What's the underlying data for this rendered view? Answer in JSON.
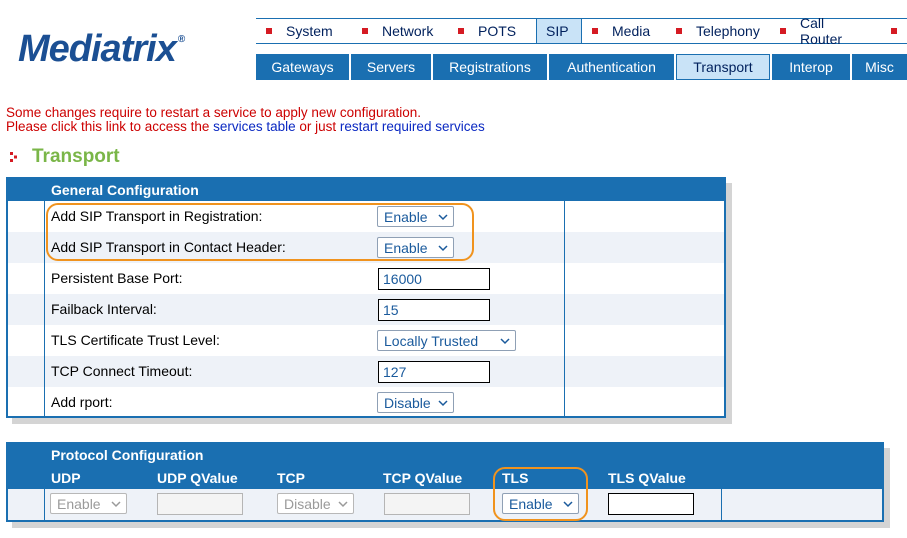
{
  "logo": {
    "text": "Mediatrix",
    "mark": "®"
  },
  "top_nav": [
    {
      "label": "System"
    },
    {
      "label": "Network"
    },
    {
      "label": "POTS"
    },
    {
      "label": "SIP",
      "active": true
    },
    {
      "label": "Media"
    },
    {
      "label": "Telephony"
    },
    {
      "label": "Call Router"
    }
  ],
  "sub_nav": [
    {
      "label": "Gateways"
    },
    {
      "label": "Servers"
    },
    {
      "label": "Registrations"
    },
    {
      "label": "Authentication"
    },
    {
      "label": "Transport",
      "active": true
    },
    {
      "label": "Interop"
    },
    {
      "label": "Misc"
    }
  ],
  "notice": {
    "line1": "Some changes require to restart a service to apply new configuration.",
    "line2_prefix": "Please click this link to access the ",
    "services_table_link": "services table",
    "line2_middle": " or just ",
    "restart_link": "restart required services"
  },
  "page_title": "Transport",
  "general": {
    "title": "General Configuration",
    "rows": [
      {
        "label": "Add SIP Transport in Registration:",
        "type": "select",
        "value": "Enable"
      },
      {
        "label": "Add SIP Transport in Contact Header:",
        "type": "select",
        "value": "Enable"
      },
      {
        "label": "Persistent Base Port:",
        "type": "input",
        "value": "16000"
      },
      {
        "label": "Failback Interval:",
        "type": "input",
        "value": "15"
      },
      {
        "label": "TLS Certificate Trust Level:",
        "type": "select",
        "value": "Locally Trusted"
      },
      {
        "label": "TCP Connect Timeout:",
        "type": "input",
        "value": "127"
      },
      {
        "label": "Add rport:",
        "type": "select",
        "value": "Disable"
      }
    ]
  },
  "protocol": {
    "title": "Protocol Configuration",
    "columns": [
      "UDP",
      "UDP QValue",
      "TCP",
      "TCP QValue",
      "TLS",
      "TLS QValue"
    ],
    "values": {
      "udp": "Enable",
      "udp_qvalue": "",
      "tcp": "Disable",
      "tcp_qvalue": "",
      "tls": "Enable",
      "tls_qvalue": ""
    }
  },
  "colors": {
    "brand_blue": "#1a6fb1",
    "title_green": "#7ab648",
    "notice_red": "#cc0000",
    "link_blue": "#0a28c2",
    "highlight_orange": "#f0931e"
  },
  "icons": [
    "chevron-down-icon",
    "title-arrow-icon",
    "nav-bullet-icon"
  ]
}
